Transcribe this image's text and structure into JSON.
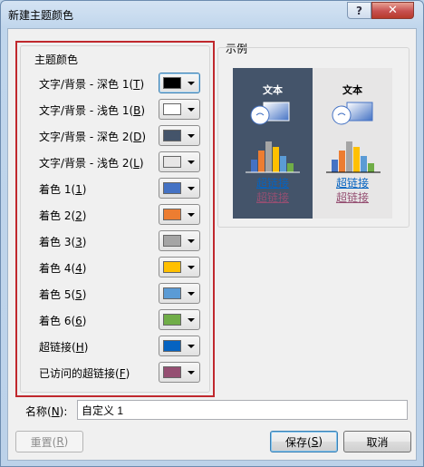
{
  "window": {
    "title": "新建主题颜色",
    "help": "?",
    "close": "✕"
  },
  "theme_group": {
    "title": "主题颜色",
    "rows": [
      {
        "label": "文字/背景 - 深色 1(",
        "key": "T",
        "suffix": ")",
        "color": "#000000",
        "focused": true
      },
      {
        "label": "文字/背景 - 浅色 1(",
        "key": "B",
        "suffix": ")",
        "color": "#ffffff"
      },
      {
        "label": "文字/背景 - 深色 2(",
        "key": "D",
        "suffix": ")",
        "color": "#44546a"
      },
      {
        "label": "文字/背景 - 浅色 2(",
        "key": "L",
        "suffix": ")",
        "color": "#e7e6e6"
      },
      {
        "label": "着色 1(",
        "key": "1",
        "suffix": ")",
        "color": "#4472c4"
      },
      {
        "label": "着色 2(",
        "key": "2",
        "suffix": ")",
        "color": "#ed7d31"
      },
      {
        "label": "着色 3(",
        "key": "3",
        "suffix": ")",
        "color": "#a5a5a5"
      },
      {
        "label": "着色 4(",
        "key": "4",
        "suffix": ")",
        "color": "#ffc000"
      },
      {
        "label": "着色 5(",
        "key": "5",
        "suffix": ")",
        "color": "#5b9bd5"
      },
      {
        "label": "着色 6(",
        "key": "6",
        "suffix": ")",
        "color": "#70ad47"
      },
      {
        "label": "超链接(",
        "key": "H",
        "suffix": ")",
        "color": "#0563c1"
      },
      {
        "label": "已访问的超链接(",
        "key": "F",
        "suffix": ")",
        "color": "#954f72"
      }
    ]
  },
  "sample": {
    "title": "示例",
    "text": "文本",
    "hyperlink": "超链接",
    "visited": "超链接",
    "link_color": "#0563c1",
    "visited_color": "#954f72"
  },
  "name_field": {
    "label": "名称(",
    "key": "N",
    "suffix": "):",
    "value": "自定义 1"
  },
  "buttons": {
    "reset": {
      "label": "重置(",
      "key": "R",
      "suffix": ")"
    },
    "save": {
      "label": "保存(",
      "key": "S",
      "suffix": ")"
    },
    "cancel": {
      "label": "取消"
    }
  }
}
